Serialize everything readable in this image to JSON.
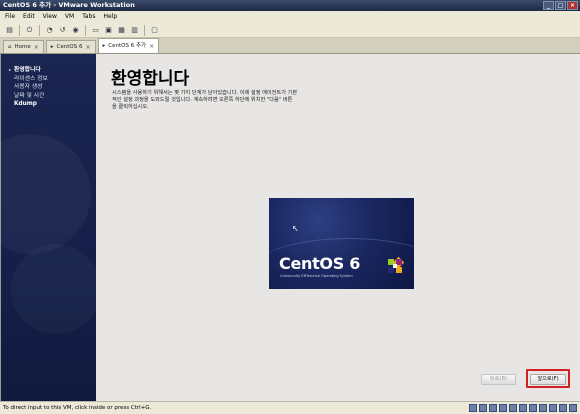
{
  "window": {
    "title": "CentOS 6 추가 - VMware Workstation"
  },
  "menu": [
    "File",
    "Edit",
    "View",
    "VM",
    "Tabs",
    "Help"
  ],
  "toolbar": {
    "icons": [
      "folder-icon",
      "power-icon",
      "snapshot-icon",
      "revert-icon",
      "manage-snapshots-icon",
      "console-icon",
      "fullscreen-icon",
      "unity-icon",
      "view-icon",
      "quickswitch-icon"
    ]
  },
  "tabs": [
    {
      "label": "Home",
      "active": false
    },
    {
      "label": "CentOS 6",
      "active": false
    },
    {
      "label": "CentOS 6 추가",
      "active": true
    }
  ],
  "sidebar": {
    "items": [
      {
        "label": "환영합니다",
        "state": "active"
      },
      {
        "label": "라이센스 정보",
        "state": "normal"
      },
      {
        "label": "사용자 생성",
        "state": "normal"
      },
      {
        "label": "날짜 및 시간",
        "state": "normal"
      },
      {
        "label": "Kdump",
        "state": "bold"
      }
    ]
  },
  "main": {
    "heading": "환영합니다",
    "description": [
      "시스템을 사용하기 위해서는 몇 가지 단계가 남아있습니다. 이제 설정 에이전트가 기본",
      "적인 설정 과정을 도와드릴 것입니다. 계속하려면 오른쪽 하단에 위치한 \"다음\" 버튼",
      "을 클릭하십시오."
    ]
  },
  "splash": {
    "logo_text": "CentOS 6",
    "tagline": "Community ENTerprise Operating System"
  },
  "buttons": {
    "back": "뒤로(B)",
    "next": "앞으로(F)"
  },
  "status": {
    "text": "To direct input to this VM, click inside or press Ctrl+G."
  },
  "colors": {
    "sidebar_bg": "#1a2550",
    "highlight": "#d42020"
  }
}
